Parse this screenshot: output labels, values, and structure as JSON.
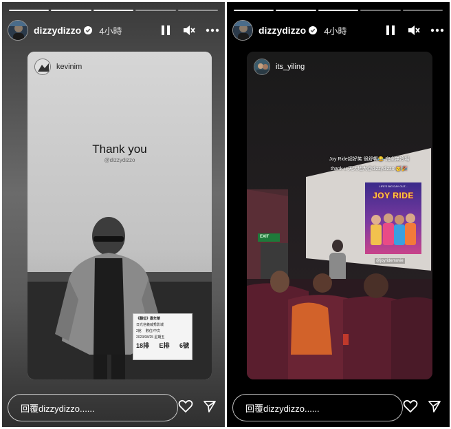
{
  "stories": [
    {
      "username": "dizzydizzo",
      "time": "4小時",
      "reply_placeholder": "回覆dizzydizzo......",
      "reposted_from": "kevinim",
      "overlay_text": "Thank you",
      "overlay_mention": "@dizzydizzo",
      "ticket": {
        "title": "《翻位》嘉年華",
        "venue": "日光信義威秀影城",
        "hall": "2館",
        "type": "數位/中文",
        "date": "2023/08/25 星期五",
        "row": "18排",
        "col": "E排",
        "seat": "6號"
      }
    },
    {
      "username": "dizzydizzo",
      "time": "4小時",
      "reply_placeholder": "回覆dizzydizzo......",
      "reposted_from": "its_yiling",
      "caption_line1": "Joy Ride超好笑 很舒暢😂 完全無冷場",
      "caption_line2": "thank u 天大地大@dizzydizzo 🥳🎉",
      "poster_title": "JOY RIDE",
      "poster_tagline": "LIFE'S BIG DAY OUT...",
      "poster_mention": "@joyridemovie",
      "exit_sign": "EXIT"
    }
  ],
  "colors": {
    "accent_red": "#c8102e",
    "verified_blue": "#3897f0",
    "seat_maroon": "#5a1e2e"
  },
  "icons": {
    "pause": "pause-icon",
    "mute": "mute-icon",
    "more": "more-icon",
    "heart": "heart-icon",
    "send": "send-icon",
    "verified": "verified-icon"
  }
}
